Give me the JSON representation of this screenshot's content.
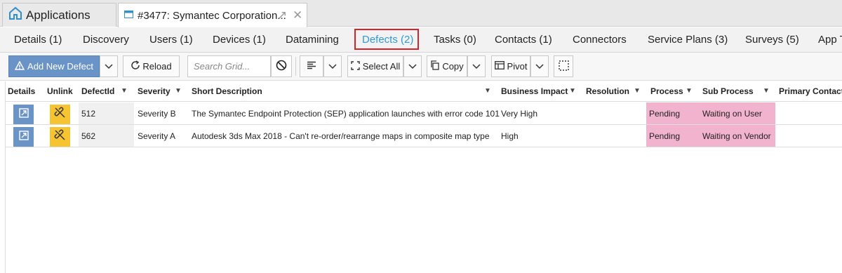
{
  "window_tabs": {
    "home_label": "Applications",
    "doc_label": "#3477: Symantec Corporation...",
    "popout_glyph": "↗",
    "close_glyph": "✕"
  },
  "subtabs": [
    {
      "label": "Details (1)"
    },
    {
      "label": "Discovery"
    },
    {
      "label": "Users (1)"
    },
    {
      "label": "Devices (1)"
    },
    {
      "label": "Datamining"
    },
    {
      "label": "Defects (2)",
      "active": true
    },
    {
      "label": "Tasks (0)"
    },
    {
      "label": "Contacts (1)"
    },
    {
      "label": "Connectors"
    },
    {
      "label": "Service Plans (3)"
    },
    {
      "label": "Surveys (5)"
    },
    {
      "label": "App T"
    }
  ],
  "toolbar": {
    "add_label": "Add New Defect",
    "reload_label": "Reload",
    "search_placeholder": "Search Grid...",
    "select_all_label": "Select All",
    "copy_label": "Copy",
    "pivot_label": "Pivot"
  },
  "grid": {
    "columns": {
      "details": "Details",
      "unlink": "Unlink",
      "defectid": "DefectId",
      "severity": "Severity",
      "short_description": "Short Description",
      "business_impact": "Business Impact",
      "resolution": "Resolution",
      "process": "Process",
      "sub_process": "Sub Process",
      "primary_contact": "Primary Contact"
    },
    "rows": [
      {
        "defectid": "512",
        "severity": "Severity B",
        "short_description": "The Symantec Endpoint Protection (SEP) application launches with error code 101",
        "business_impact": "Very High",
        "resolution": "",
        "process": "Pending",
        "sub_process": "Waiting on User",
        "primary_contact": ""
      },
      {
        "defectid": "562",
        "severity": "Severity A",
        "short_description": "Autodesk 3ds Max 2018 - Can't re-order/rearrange maps in composite map type",
        "business_impact": "High",
        "resolution": "",
        "process": "Pending",
        "sub_process": "Waiting on Vendor",
        "primary_contact": ""
      }
    ]
  },
  "colors": {
    "accent": "#2f9ad6",
    "highlight_border": "#d6242c",
    "primary_button": "#6a94c8",
    "unlink_button": "#f6c431",
    "pending_bg": "#f2b3cf"
  }
}
